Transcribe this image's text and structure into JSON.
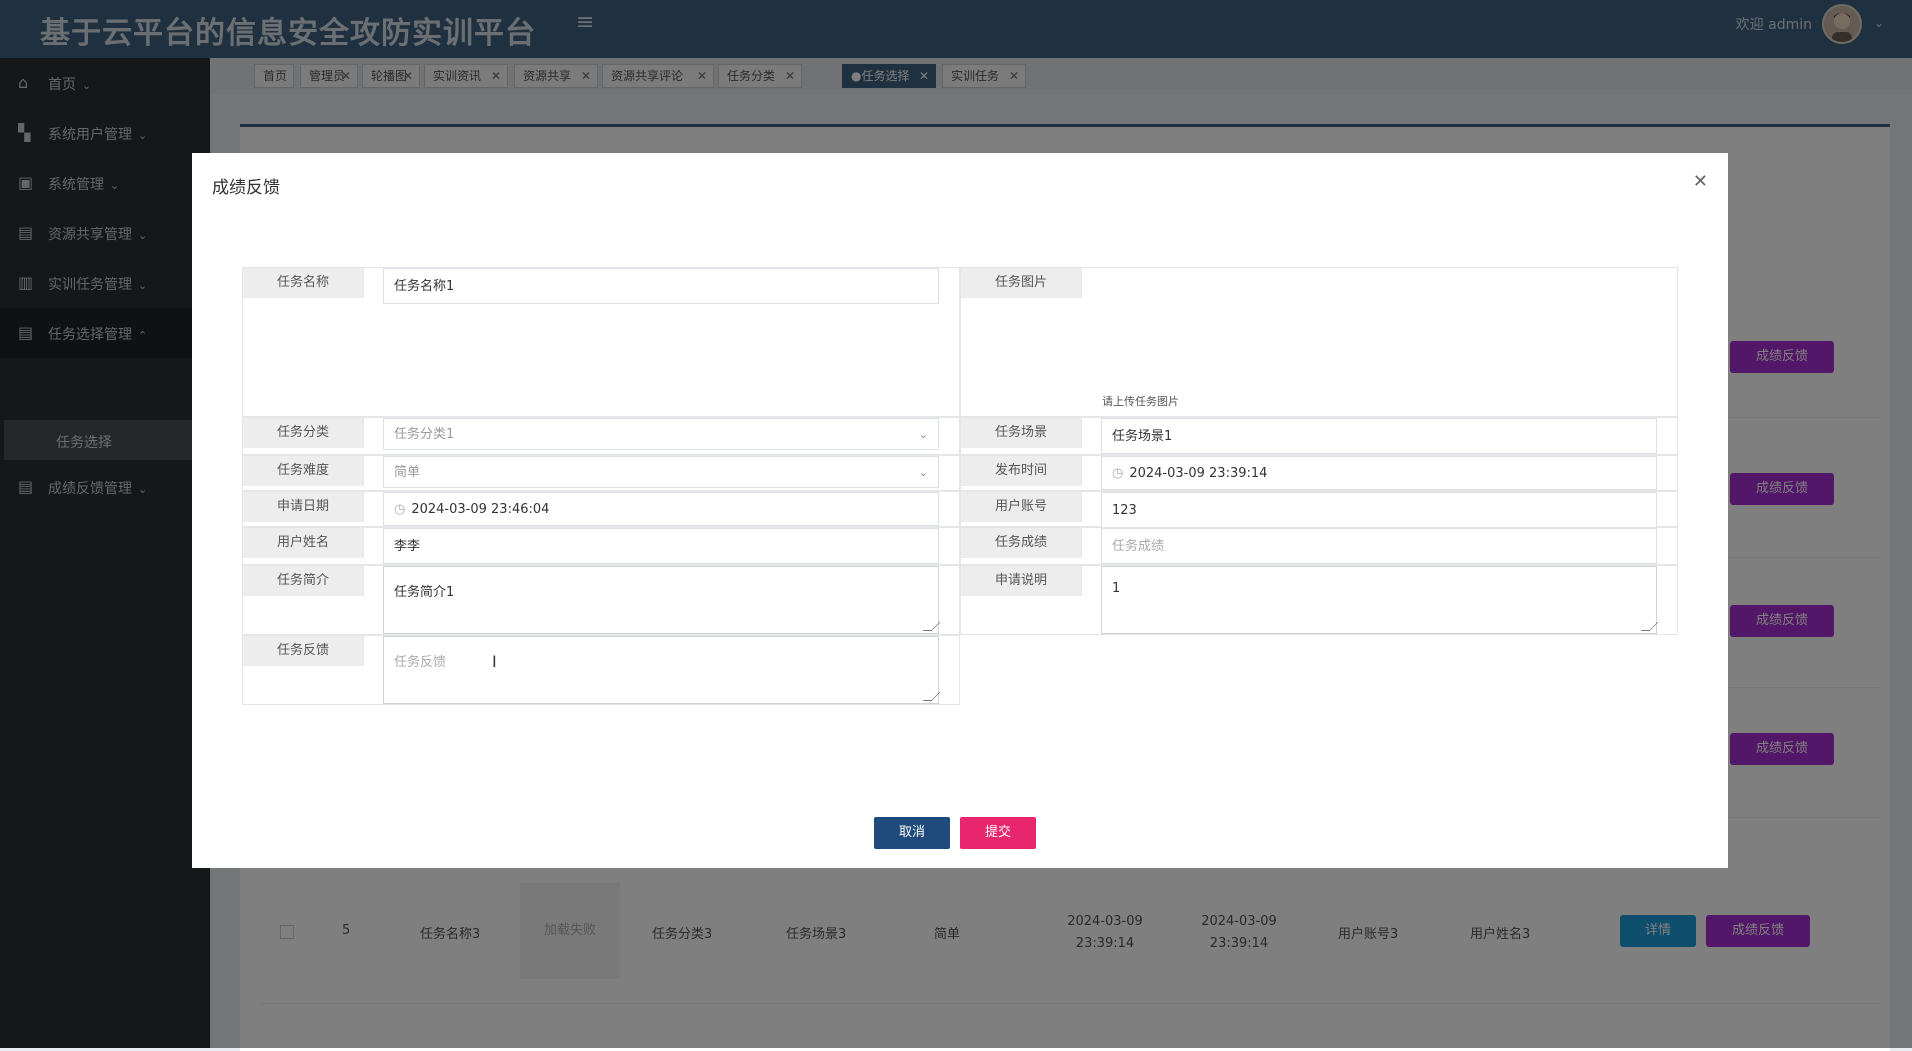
{
  "header": {
    "title": "基于云平台的信息安全攻防实训平台",
    "welcome": "欢迎 admin"
  },
  "sidebar": {
    "items": [
      {
        "label": "首页",
        "icon": "home-icon"
      },
      {
        "label": "系统用户管理",
        "icon": "users-icon"
      },
      {
        "label": "系统管理",
        "icon": "briefcase-icon"
      },
      {
        "label": "资源共享管理",
        "icon": "archive-icon"
      },
      {
        "label": "实训任务管理",
        "icon": "book-icon"
      },
      {
        "label": "任务选择管理",
        "icon": "archive-icon"
      },
      {
        "label": "成绩反馈管理",
        "icon": "archive-icon"
      }
    ],
    "sub_item": "任务选择"
  },
  "tabs": [
    "首页",
    "管理员",
    "轮播图",
    "实训资讯",
    "资源共享",
    "资源共享评论",
    "任务分类",
    "●任务选择",
    "实训任务"
  ],
  "background": {
    "feedback_label": "成绩反馈",
    "detail_label": "详情",
    "last_row": {
      "index": "5",
      "task_name": "任务名称3",
      "image": "加载失败",
      "category": "任务分类3",
      "scene": "任务场景3",
      "difficulty": "简单",
      "publish_time": "2024-03-09 23:39:14",
      "apply_date": "2024-03-09 23:39:14",
      "account": "用户账号3",
      "username": "用户姓名3"
    }
  },
  "modal": {
    "title": "成绩反馈",
    "fields": {
      "task_name": {
        "label": "任务名称",
        "value": "任务名称1"
      },
      "task_image": {
        "label": "任务图片",
        "hint": "请上传任务图片"
      },
      "category": {
        "label": "任务分类",
        "value": "任务分类1"
      },
      "scene": {
        "label": "任务场景",
        "value": "任务场景1"
      },
      "difficulty": {
        "label": "任务难度",
        "value": "简单"
      },
      "publish_time": {
        "label": "发布时间",
        "value": "2024-03-09 23:39:14"
      },
      "apply_date": {
        "label": "申请日期",
        "value": "2024-03-09 23:46:04"
      },
      "account": {
        "label": "用户账号",
        "value": "123"
      },
      "username": {
        "label": "用户姓名",
        "value": "李李"
      },
      "score": {
        "label": "任务成绩",
        "placeholder": "任务成绩"
      },
      "intro": {
        "label": "任务简介",
        "value": "任务简介1"
      },
      "apply_note": {
        "label": "申请说明",
        "value": "1"
      },
      "feedback": {
        "label": "任务反馈",
        "placeholder": "任务反馈"
      }
    },
    "cancel": "取消",
    "submit": "提交"
  },
  "colors": {
    "header": "#3f6280",
    "sidebar": "#2b2f33",
    "cancel_btn": "#1f4b7c",
    "submit_btn": "#e8266e",
    "feedback_btn": "#a52fd1",
    "detail_btn": "#1e9bd8"
  }
}
